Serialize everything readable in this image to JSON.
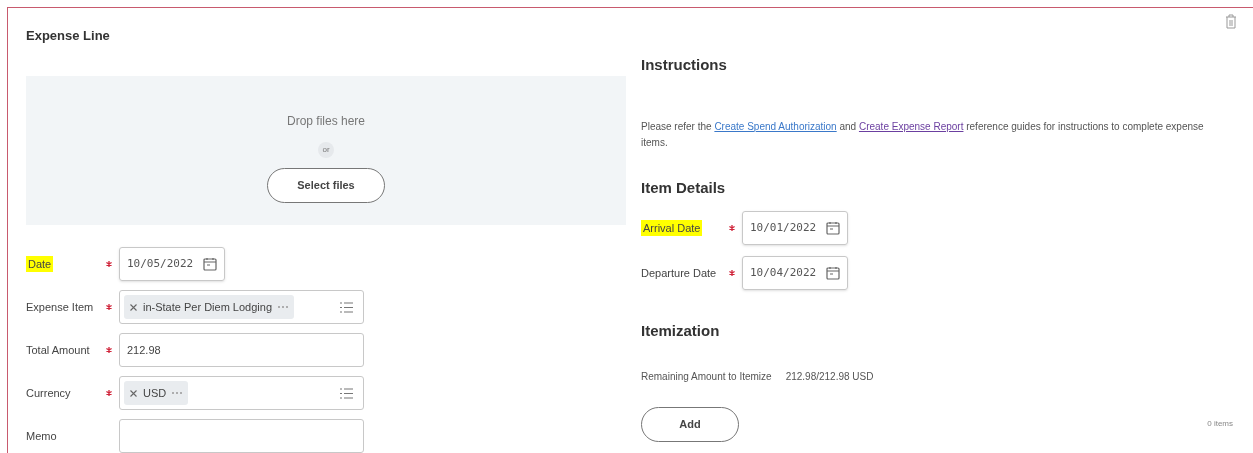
{
  "title": "Expense Line",
  "dropzone": {
    "prompt": "Drop files here",
    "separator": "or",
    "button": "Select files"
  },
  "fields": [
    {
      "kind": "date",
      "label": "Date",
      "highlighted": true,
      "required": true,
      "value": "10/05/2022"
    },
    {
      "kind": "multiselect",
      "label": "Expense Item",
      "highlighted": false,
      "required": true,
      "value": "in-State Per Diem Lodging"
    },
    {
      "kind": "text",
      "label": "Total Amount",
      "highlighted": false,
      "required": true,
      "value": "212.98"
    },
    {
      "kind": "multiselect",
      "label": "Currency",
      "highlighted": false,
      "required": true,
      "value": "USD"
    },
    {
      "kind": "text",
      "label": "Memo",
      "highlighted": false,
      "required": false
    }
  ],
  "instructions": {
    "heading": "Instructions",
    "text_before": "Please refer the",
    "link_1": "Create Spend Authorization",
    "text_middle": "and",
    "link_2": "Create Expense Report",
    "text_after": "reference guides for instructions to complete expense items."
  },
  "item_details": {
    "heading": "Item Details",
    "fields": [
      {
        "kind": "date",
        "label": "Arrival Date",
        "highlighted": true,
        "required": true,
        "value": "10/01/2022"
      },
      {
        "kind": "date",
        "label": "Departure Date",
        "highlighted": false,
        "required": true,
        "value": "10/04/2022"
      }
    ]
  },
  "itemization": {
    "heading": "Itemization",
    "remaining_label": "Remaining Amount to Itemize",
    "remaining_value": "212.98/212.98 USD",
    "add_button": "Add",
    "count": "0 items"
  }
}
